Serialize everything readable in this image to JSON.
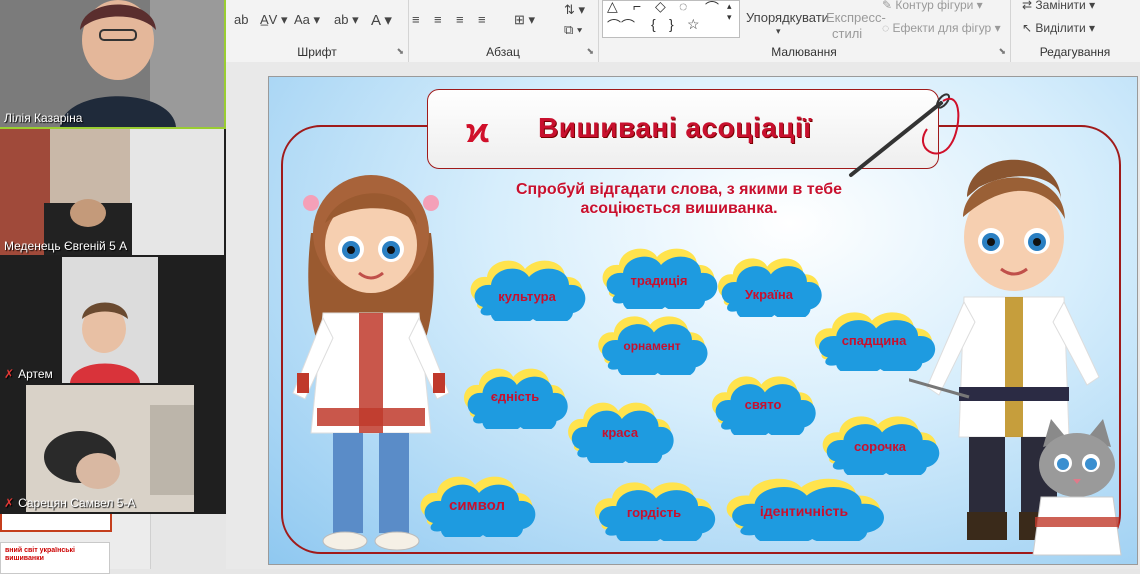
{
  "ribbon": {
    "groups": {
      "font": "Шрифт",
      "paragraph": "Абзац",
      "drawing": "Малювання",
      "editing": "Редагування"
    },
    "buttons": {
      "arrange": "Упорядкувати",
      "quick_styles_line1": "Експресс-",
      "quick_styles_line2": "стилі",
      "shape_outline": "Контур фігури",
      "shape_effects": "Ефекти для фігур",
      "replace": "Замінити",
      "select": "Виділити"
    }
  },
  "slide": {
    "title": "Вишивані асоціації",
    "subtitle_line1": "Спробуй відгадати слова, з якими в тебе",
    "subtitle_line2": "асоціюється вишиванка.",
    "clouds": [
      "культура",
      "традиція",
      "Україна",
      "орнамент",
      "спадщина",
      "єдність",
      "свято",
      "краса",
      "сорочка",
      "символ",
      "гордість",
      "ідентичність"
    ]
  },
  "participants": [
    {
      "name": "Лілія Казаріна",
      "muted": false
    },
    {
      "name": "Меденець Євгеній 5 А",
      "muted": false
    },
    {
      "name": "Артем",
      "muted": true
    },
    {
      "name": "Сарецян Самвел 5-А",
      "muted": true
    }
  ],
  "thumbnail": {
    "text_line1": "вний світ українські",
    "text_line2": "вишиванки"
  },
  "colors": {
    "accent_red": "#c8102e",
    "cloud_blue": "#1e9be0",
    "cloud_yellow": "#ffe34d",
    "active_speaker": "#9acd32"
  }
}
